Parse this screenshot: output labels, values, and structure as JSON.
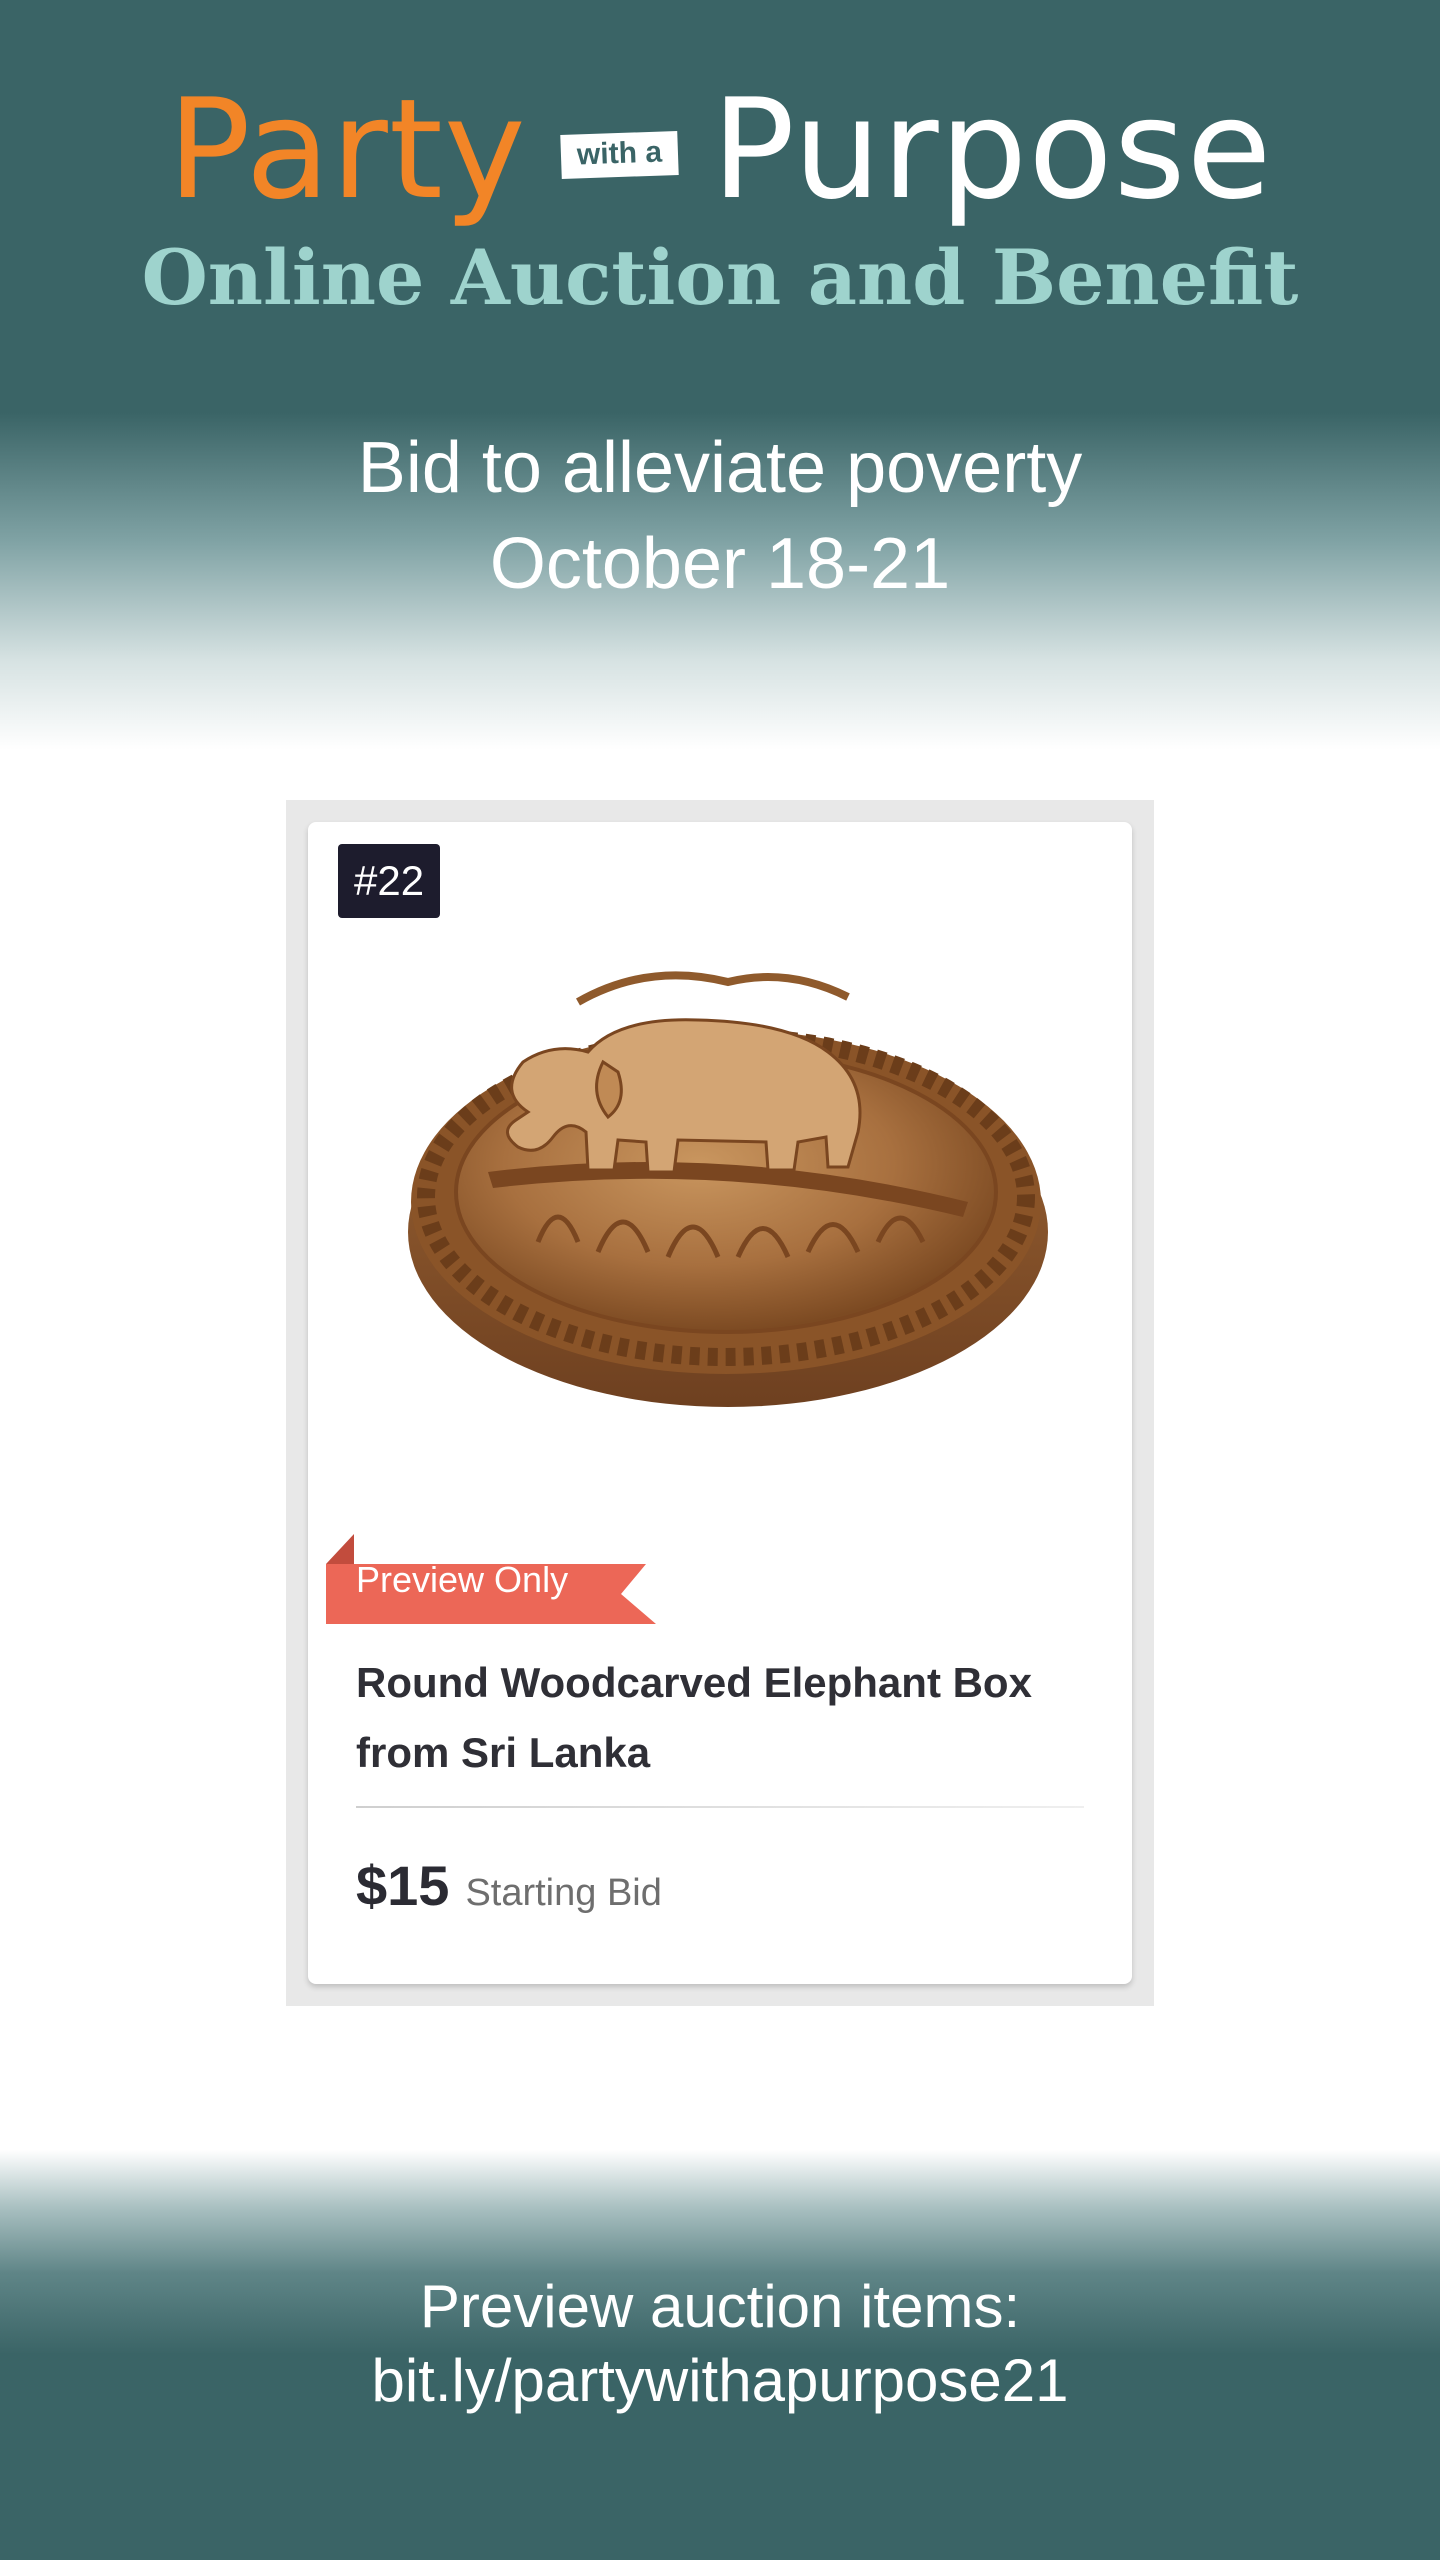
{
  "header": {
    "logo_party": "Party",
    "logo_with_a": "with a",
    "logo_purpose": "Purpose",
    "subtitle": "Online Auction and Benefit",
    "tagline_line1": "Bid to alleviate poverty",
    "tagline_line2": "October 18-21"
  },
  "item_card": {
    "lot_number": "#22",
    "status_ribbon": "Preview Only",
    "title_line1": "Round Woodcarved Elephant Box",
    "title_line2": "from Sri Lanka",
    "price": "$15",
    "price_label": "Starting Bid",
    "image_subject": "carved-wooden-elephant-box"
  },
  "footer": {
    "line1": "Preview auction items:",
    "line2": "bit.ly/partywithapurpose21"
  },
  "colors": {
    "teal_background": "#3a6466",
    "orange_accent": "#f28527",
    "mint_subtitle": "#9ed3cd",
    "ribbon_red": "#ec6757",
    "badge_dark": "#1d1c2d"
  }
}
